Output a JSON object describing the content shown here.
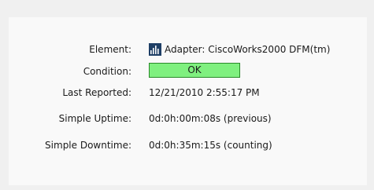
{
  "fields": {
    "element": {
      "label": "Element:",
      "icon": "adapter-icon",
      "value": "Adapter: CiscoWorks2000 DFM(tm)"
    },
    "condition": {
      "label": "Condition:",
      "value": "OK",
      "status_color": "#7ff07f",
      "status_border": "#2a8a2a"
    },
    "last_reported": {
      "label": "Last Reported:",
      "value": "12/21/2010 2:55:17 PM"
    },
    "simple_uptime": {
      "label": "Simple Uptime:",
      "value": "0d:0h:00m:08s (previous)"
    },
    "simple_downtime": {
      "label": "Simple Downtime:",
      "value": "0d:0h:35m:15s (counting)"
    }
  }
}
